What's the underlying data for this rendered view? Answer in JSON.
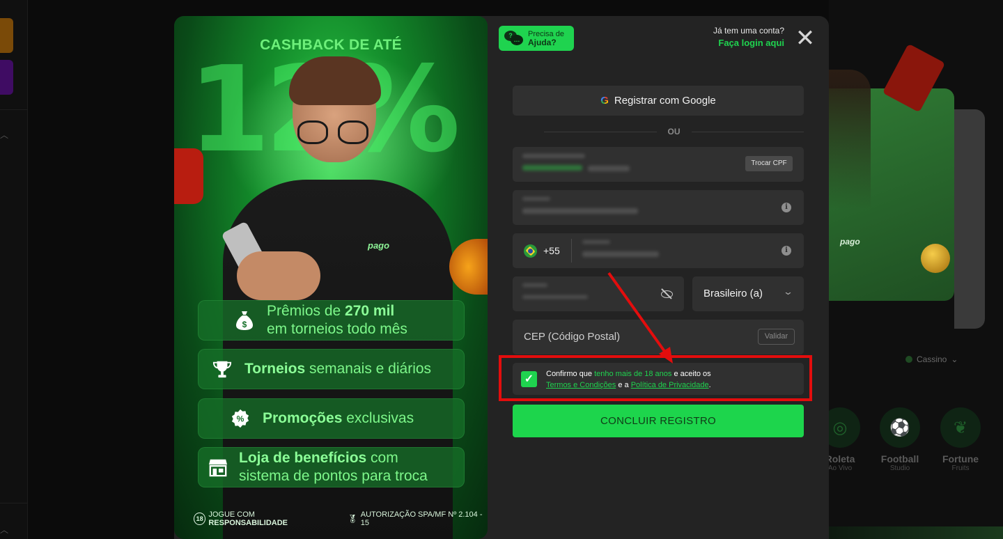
{
  "background": {
    "category_label": "Cassino",
    "games": [
      {
        "name": "Roleta",
        "sub": "Ao Vivo"
      },
      {
        "name": "Football",
        "sub": "Studio"
      },
      {
        "name": "Fortune",
        "sub": "Fruits"
      }
    ],
    "promo_logo": "pago"
  },
  "promo": {
    "headline": "CASHBACK DE ATÉ",
    "percent": "12%",
    "shirt_logo": "pago",
    "features": [
      {
        "icon": "money-bag-icon",
        "pre": "Prêmios de ",
        "bold": "270 mil",
        "post": "em torneios todo mês"
      },
      {
        "icon": "trophy-icon",
        "bold": "Torneios",
        "post": " semanais e diários"
      },
      {
        "icon": "percent-badge-icon",
        "bold": "Promoções",
        "post": " exclusivas"
      },
      {
        "icon": "store-icon",
        "bold": "Loja de benefícios",
        "post": " com",
        "line2": "sistema de pontos para troca"
      }
    ],
    "footer": {
      "age": "18",
      "responsible_pre": "JOGUE COM ",
      "responsible_bold": "RESPONSABILIDADE",
      "authorization": "AUTORIZAÇÃO SPA/MF Nº 2.104 - 15"
    }
  },
  "header": {
    "help_line1": "Precisa de",
    "help_line2": "Ajuda?",
    "login_question": "Já tem uma conta?",
    "login_link": "Faça login aqui",
    "close": "✕"
  },
  "form": {
    "google_label": "Registrar com Google",
    "or_label": "OU",
    "cpf_switch_label": "Trocar CPF",
    "phone_prefix": "+55",
    "nationality": "Brasileiro (a)",
    "cep_placeholder": "CEP (Código Postal)",
    "validate_label": "Validar",
    "consent": {
      "checked": true,
      "t1": "Confirmo que ",
      "t2": "tenho mais de 18 anos",
      "t3": " e aceito os",
      "terms": "Termos e Condições",
      "t4": " e a ",
      "privacy": "Política de Privacidade",
      "t5": "."
    },
    "submit_label": "CONCLUIR REGISTRO"
  },
  "colors": {
    "accent": "#1fd34f",
    "highlight_border": "#e30d0d",
    "panel_bg": "#232323",
    "field_bg": "#303030"
  }
}
